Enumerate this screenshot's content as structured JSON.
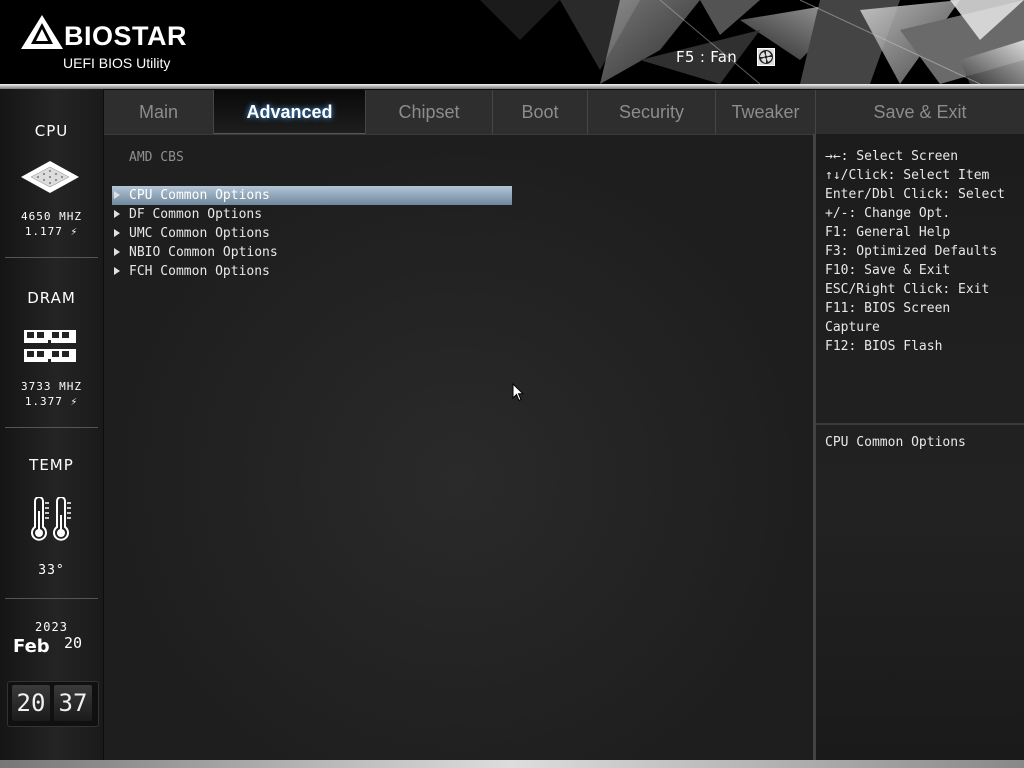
{
  "header": {
    "brand": "BIOSTAR",
    "subtitle": "UEFI BIOS Utility",
    "fan_label": "F5 : Fan"
  },
  "sidebar": {
    "cpu": {
      "title": "CPU",
      "freq": "4650 MHZ",
      "volt": "1.177 ⚡"
    },
    "dram": {
      "title": "DRAM",
      "freq": "3733 MHZ",
      "volt": "1.377 ⚡"
    },
    "temp": {
      "title": "TEMP",
      "value": "33°"
    },
    "date": {
      "year": "2023",
      "month": "Feb",
      "day": "20"
    },
    "time": {
      "hour": "20",
      "minute": "37"
    }
  },
  "tabs": [
    {
      "label": "Main",
      "active": false
    },
    {
      "label": "Advanced",
      "active": true
    },
    {
      "label": "Chipset",
      "active": false
    },
    {
      "label": "Boot",
      "active": false
    },
    {
      "label": "Security",
      "active": false
    },
    {
      "label": "Tweaker",
      "active": false
    },
    {
      "label": "Save & Exit",
      "active": false
    }
  ],
  "main": {
    "section_title": "AMD CBS",
    "items": [
      {
        "label": "CPU Common Options",
        "selected": true
      },
      {
        "label": "DF Common Options",
        "selected": false
      },
      {
        "label": "UMC Common Options",
        "selected": false
      },
      {
        "label": "NBIO Common Options",
        "selected": false
      },
      {
        "label": "FCH Common Options",
        "selected": false
      }
    ]
  },
  "help": {
    "lines": [
      "→←: Select Screen",
      "↑↓/Click: Select Item",
      "Enter/Dbl Click: Select",
      "+/-: Change Opt.",
      "F1: General Help",
      "F3: Optimized Defaults",
      "F10: Save & Exit",
      "ESC/Right Click: Exit",
      "F11: BIOS Screen",
      "Capture",
      "F12: BIOS Flash"
    ],
    "description": "CPU Common Options"
  },
  "colors": {
    "selection_top": "#b3c6d6",
    "selection_bottom": "#6f879c",
    "active_tab_glow": "#4aa8ff"
  },
  "icons": {
    "logo": "biostar-triangle-logo",
    "fan": "fan-icon",
    "cpu": "cpu-chip-icon",
    "dram": "memory-module-icon",
    "temp": "thermometer-icon",
    "cursor": "mouse-pointer-icon"
  }
}
